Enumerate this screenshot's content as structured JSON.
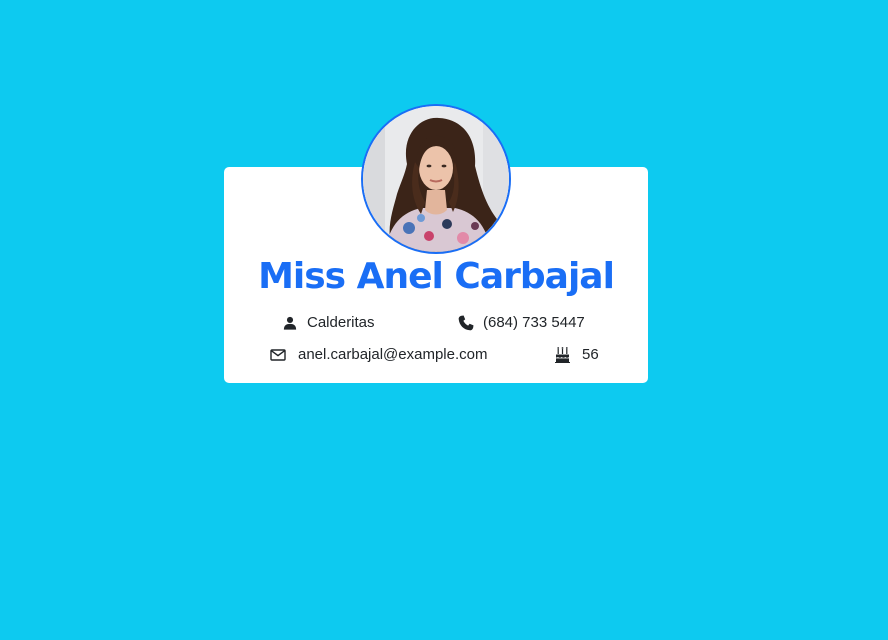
{
  "profile": {
    "name": "Miss Anel Carbajal",
    "location": "Calderitas",
    "phone": "(684) 733 5447",
    "email": "anel.carbajal@example.com",
    "age": "56"
  },
  "icons": {
    "location": "person-icon",
    "phone": "phone-icon",
    "email": "envelope-icon",
    "age": "birthday-cake-icon"
  },
  "colors": {
    "background": "#0dcaf0",
    "accent": "#1a6ef5",
    "card": "#ffffff",
    "text": "#212529"
  }
}
